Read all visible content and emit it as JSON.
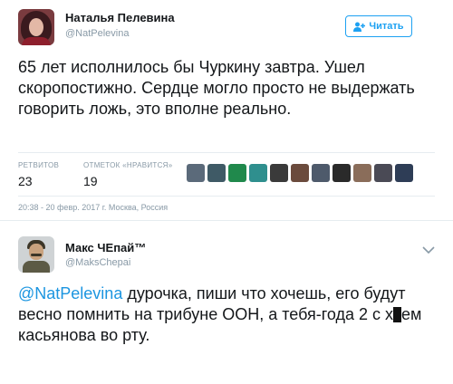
{
  "tweet1": {
    "author_name": "Наталья Пелевина",
    "author_handle": "@NatPelevina",
    "follow_label": "Читать",
    "text": "65 лет исполнилось бы Чуркину завтра. Ушел скоропостижно. Сердце могло просто не выдержать говорить ложь, это вполне реально.",
    "retweets_label": "РЕТВИТОВ",
    "retweets_count": "23",
    "likes_label": "ОТМЕТОК «НРАВИТСЯ»",
    "likes_count": "19",
    "meta": "20:38 - 20 февр. 2017 г. Москва, Россия",
    "liker_colors": [
      "#5b6a7a",
      "#3f5a66",
      "#20894c",
      "#2f8f8e",
      "#3a3a3a",
      "#6b4b3d",
      "#4e5a6b",
      "#2a2a2a",
      "#8a6d5a",
      "#4a4a55",
      "#2e3d56"
    ]
  },
  "tweet2": {
    "author_name": "Макс ЧЕпай™",
    "author_handle": "@MaksChepai",
    "mention": "@NatPelevina",
    "text_after_mention": " дурочка, пиши что хочешь, его будут весно помнить на трибуне ООН, а тебя-года 2 с х",
    "text_tail": "ем касьянова во рту."
  },
  "icons": {
    "follow": "follow-user-icon",
    "menu": "chevron-down-icon"
  },
  "colors": {
    "accent": "#1da1f2",
    "mention": "#1b95e0",
    "muted": "#8899a6",
    "divider": "#e6ecf0"
  }
}
